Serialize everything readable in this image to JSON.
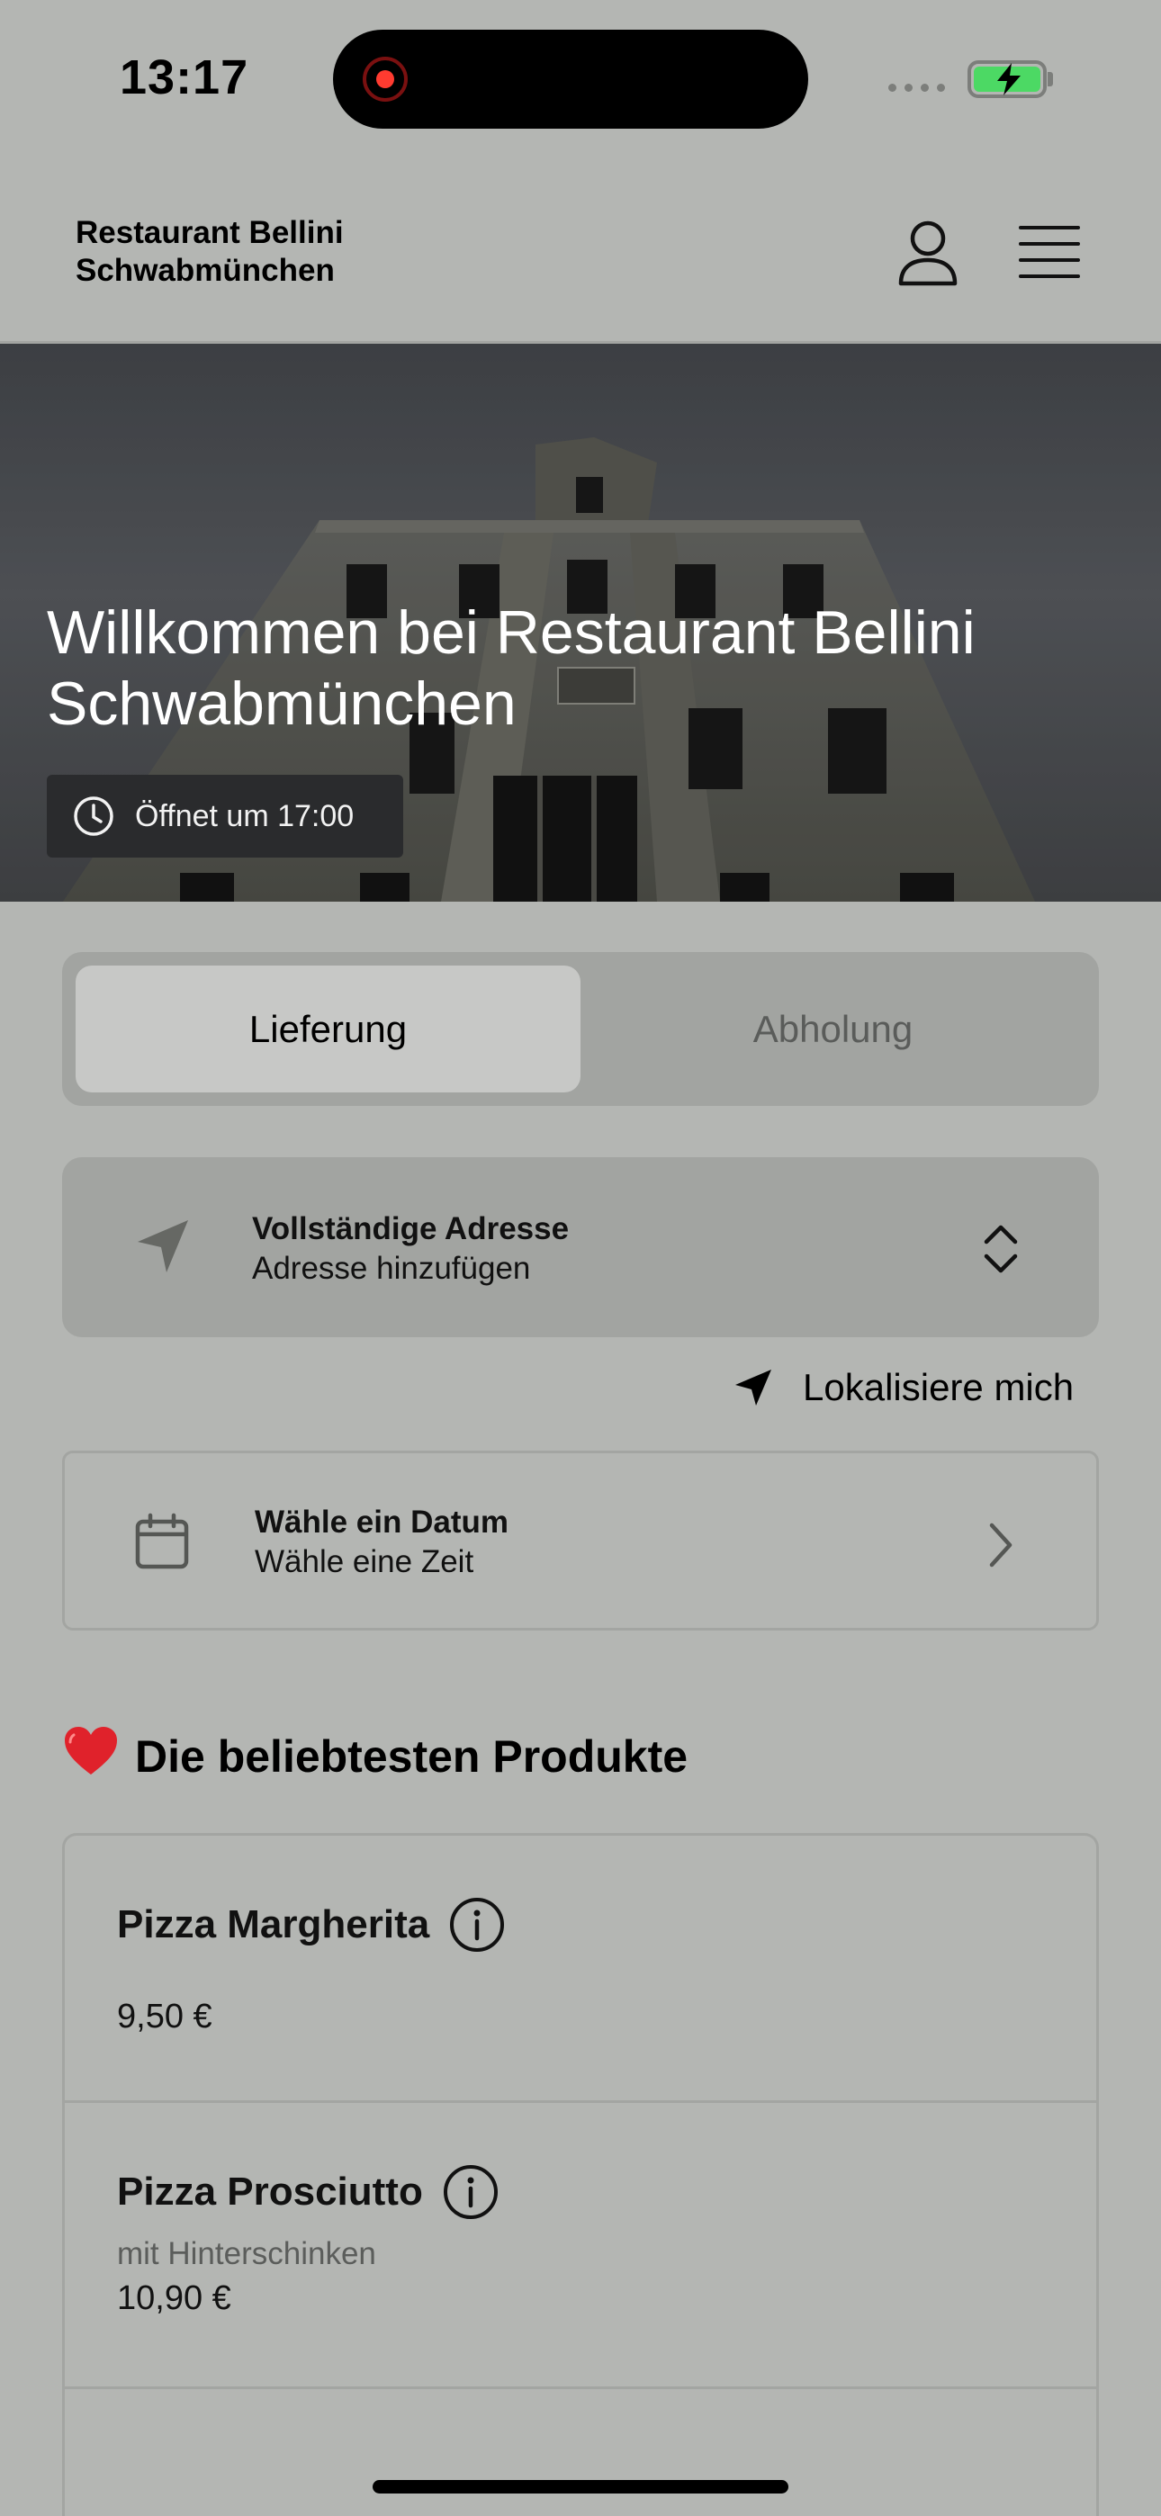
{
  "status_bar": {
    "time": "13:17"
  },
  "header": {
    "brand_line1": "Restaurant Bellini",
    "brand_line2": "Schwabmünchen",
    "user_icon": "user-icon",
    "menu_icon": "hamburger-menu-icon"
  },
  "hero": {
    "title": "Willkommen bei Restaurant Bellini Schwabmünchen",
    "opening": "Öffnet um 17:00",
    "opening_icon": "clock-icon"
  },
  "mode_tabs": {
    "items": [
      {
        "label": "Lieferung",
        "active": true
      },
      {
        "label": "Abholung",
        "active": false
      }
    ]
  },
  "address": {
    "title": "Vollständige Adresse",
    "subtitle": "Adresse hinzufügen",
    "icon": "navigation-arrow-icon"
  },
  "locate": {
    "label": "Lokalisiere mich"
  },
  "schedule": {
    "title": "Wähle ein Datum",
    "subtitle": "Wähle eine Zeit",
    "icon": "calendar-icon"
  },
  "popular": {
    "title": "Die beliebtesten Produkte",
    "emoji": "❤️",
    "products": [
      {
        "name": "Pizza Margherita",
        "description": "",
        "price": "9,50 €"
      },
      {
        "name": "Pizza Prosciutto",
        "description": "mit Hinterschinken",
        "price": "10,90 €"
      }
    ]
  },
  "colors": {
    "background": "#b4b6b3",
    "card": "#a2a4a1",
    "active_tab": "#c7c8c6",
    "battery": "#4cd964"
  }
}
